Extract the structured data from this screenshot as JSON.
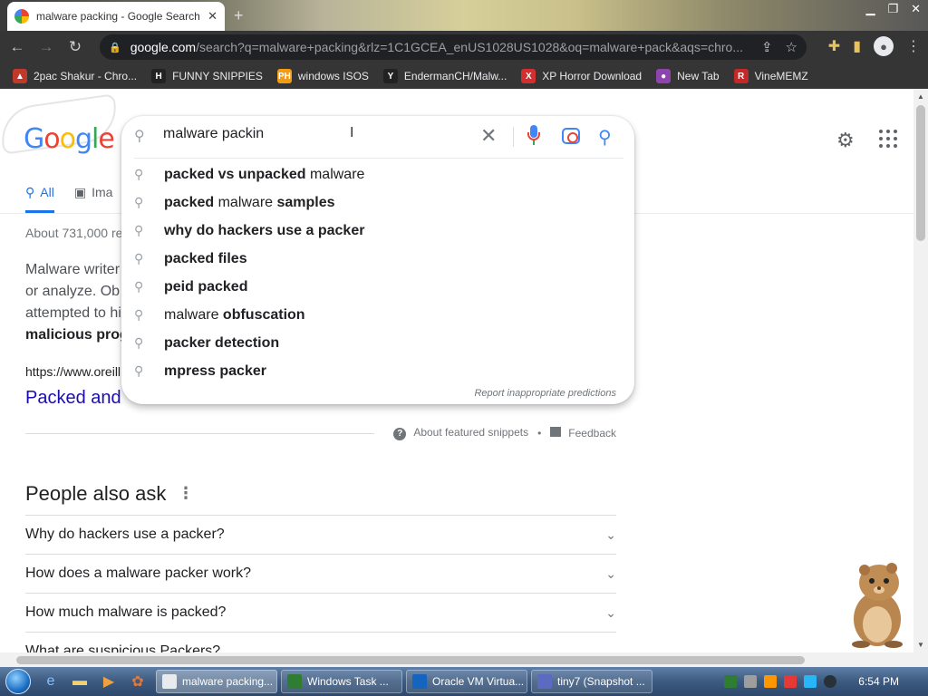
{
  "browser": {
    "tab_title": "malware packing - Google Search",
    "url_domain": "google.com",
    "url_path": "/search?q=malware+packing&rlz=1C1GCEA_enUS1028US1028&oq=malware+pack&aqs=chro..."
  },
  "bookmarks": [
    {
      "label": "2pac Shakur - Chro...",
      "icon": "bookmark-2pac-icon",
      "color": "#c0392b",
      "glyph": "▲"
    },
    {
      "label": "FUNNY SNIPPIES",
      "icon": "bookmark-h-icon",
      "color": "#222222",
      "glyph": "H"
    },
    {
      "label": "windows ISOS",
      "icon": "bookmark-ph-icon",
      "color": "#f39c12",
      "glyph": "PH"
    },
    {
      "label": "EndermanCH/Malw...",
      "icon": "bookmark-yt-icon",
      "color": "#222222",
      "glyph": "Y"
    },
    {
      "label": "XP Horror Download",
      "icon": "bookmark-x-icon",
      "color": "#d32f2f",
      "glyph": "X"
    },
    {
      "label": "New Tab",
      "icon": "bookmark-newtab-icon",
      "color": "#8e44ad",
      "glyph": "●"
    },
    {
      "label": "VineMEMZ",
      "icon": "bookmark-r-icon",
      "color": "#c62828",
      "glyph": "R"
    }
  ],
  "search": {
    "query": "malware packin",
    "suggestions": [
      {
        "prefix": "packed vs unpacked",
        "rest": " malware",
        "prefix_bold": true,
        "rest_bold": false
      },
      {
        "prefix": "packed",
        "rest": " malware ",
        "tail": "samples",
        "prefix_bold": true
      },
      {
        "prefix": "why do hackers use a packer",
        "rest": "",
        "prefix_bold": true
      },
      {
        "prefix": "packed files",
        "rest": "",
        "prefix_bold": true
      },
      {
        "prefix": "peid packed",
        "rest": "",
        "prefix_bold": true
      },
      {
        "prefix": "malware",
        "rest": " obfuscation",
        "prefix_bold": false
      },
      {
        "prefix": "packer detection",
        "rest": "",
        "prefix_bold": true
      },
      {
        "prefix": "mpress packer",
        "rest": "",
        "prefix_bold": true
      }
    ],
    "report_text": "Report inappropriate predictions"
  },
  "results": {
    "tabs": [
      "All",
      "Ima"
    ],
    "stats": "About 731,000 re",
    "snippet_lines": [
      "Malware writer",
      "or analyze. Ob",
      "attempted to hi",
      "malicious prog"
    ],
    "cite": "https://www.oreill",
    "title": "Packed and",
    "about_snippets": "About featured snippets",
    "bullet": "•",
    "feedback": "Feedback"
  },
  "people_also_ask": {
    "title": "People also ask",
    "questions": [
      "Why do hackers use a packer?",
      "How does a malware packer work?",
      "How much malware is packed?",
      "What are suspicious Packers?"
    ]
  },
  "taskbar": {
    "tasks": [
      {
        "label": "malware packing...",
        "color": "#e8eaed",
        "active": true
      },
      {
        "label": "Windows Task ...",
        "color": "#2e7d32",
        "active": false
      },
      {
        "label": "Oracle VM Virtua...",
        "color": "#1565c0",
        "active": false
      },
      {
        "label": "tiny7 (Snapshot ...",
        "color": "#5c6bc0",
        "active": false
      }
    ],
    "clock": "6:54 PM"
  }
}
